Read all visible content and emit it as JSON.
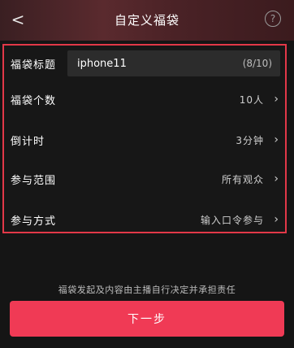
{
  "header": {
    "back_icon": "chevron-left-icon",
    "title": "自定义福袋",
    "help_label": "?"
  },
  "form": {
    "title_row": {
      "label": "福袋标题",
      "value": "iphone11",
      "counter": "(8/10)"
    },
    "rows": [
      {
        "label": "福袋个数",
        "value": "10人"
      },
      {
        "label": "倒计时",
        "value": "3分钟"
      },
      {
        "label": "参与范围",
        "value": "所有观众"
      },
      {
        "label": "参与方式",
        "value": "输入口令参与"
      }
    ],
    "chevron_glyph": "›"
  },
  "footer": {
    "note": "福袋发起及内容由主播自行决定并承担责任",
    "next_label": "下一步"
  },
  "colors": {
    "accent": "#f03a55",
    "highlight_border": "#e23848",
    "background": "#151515"
  }
}
